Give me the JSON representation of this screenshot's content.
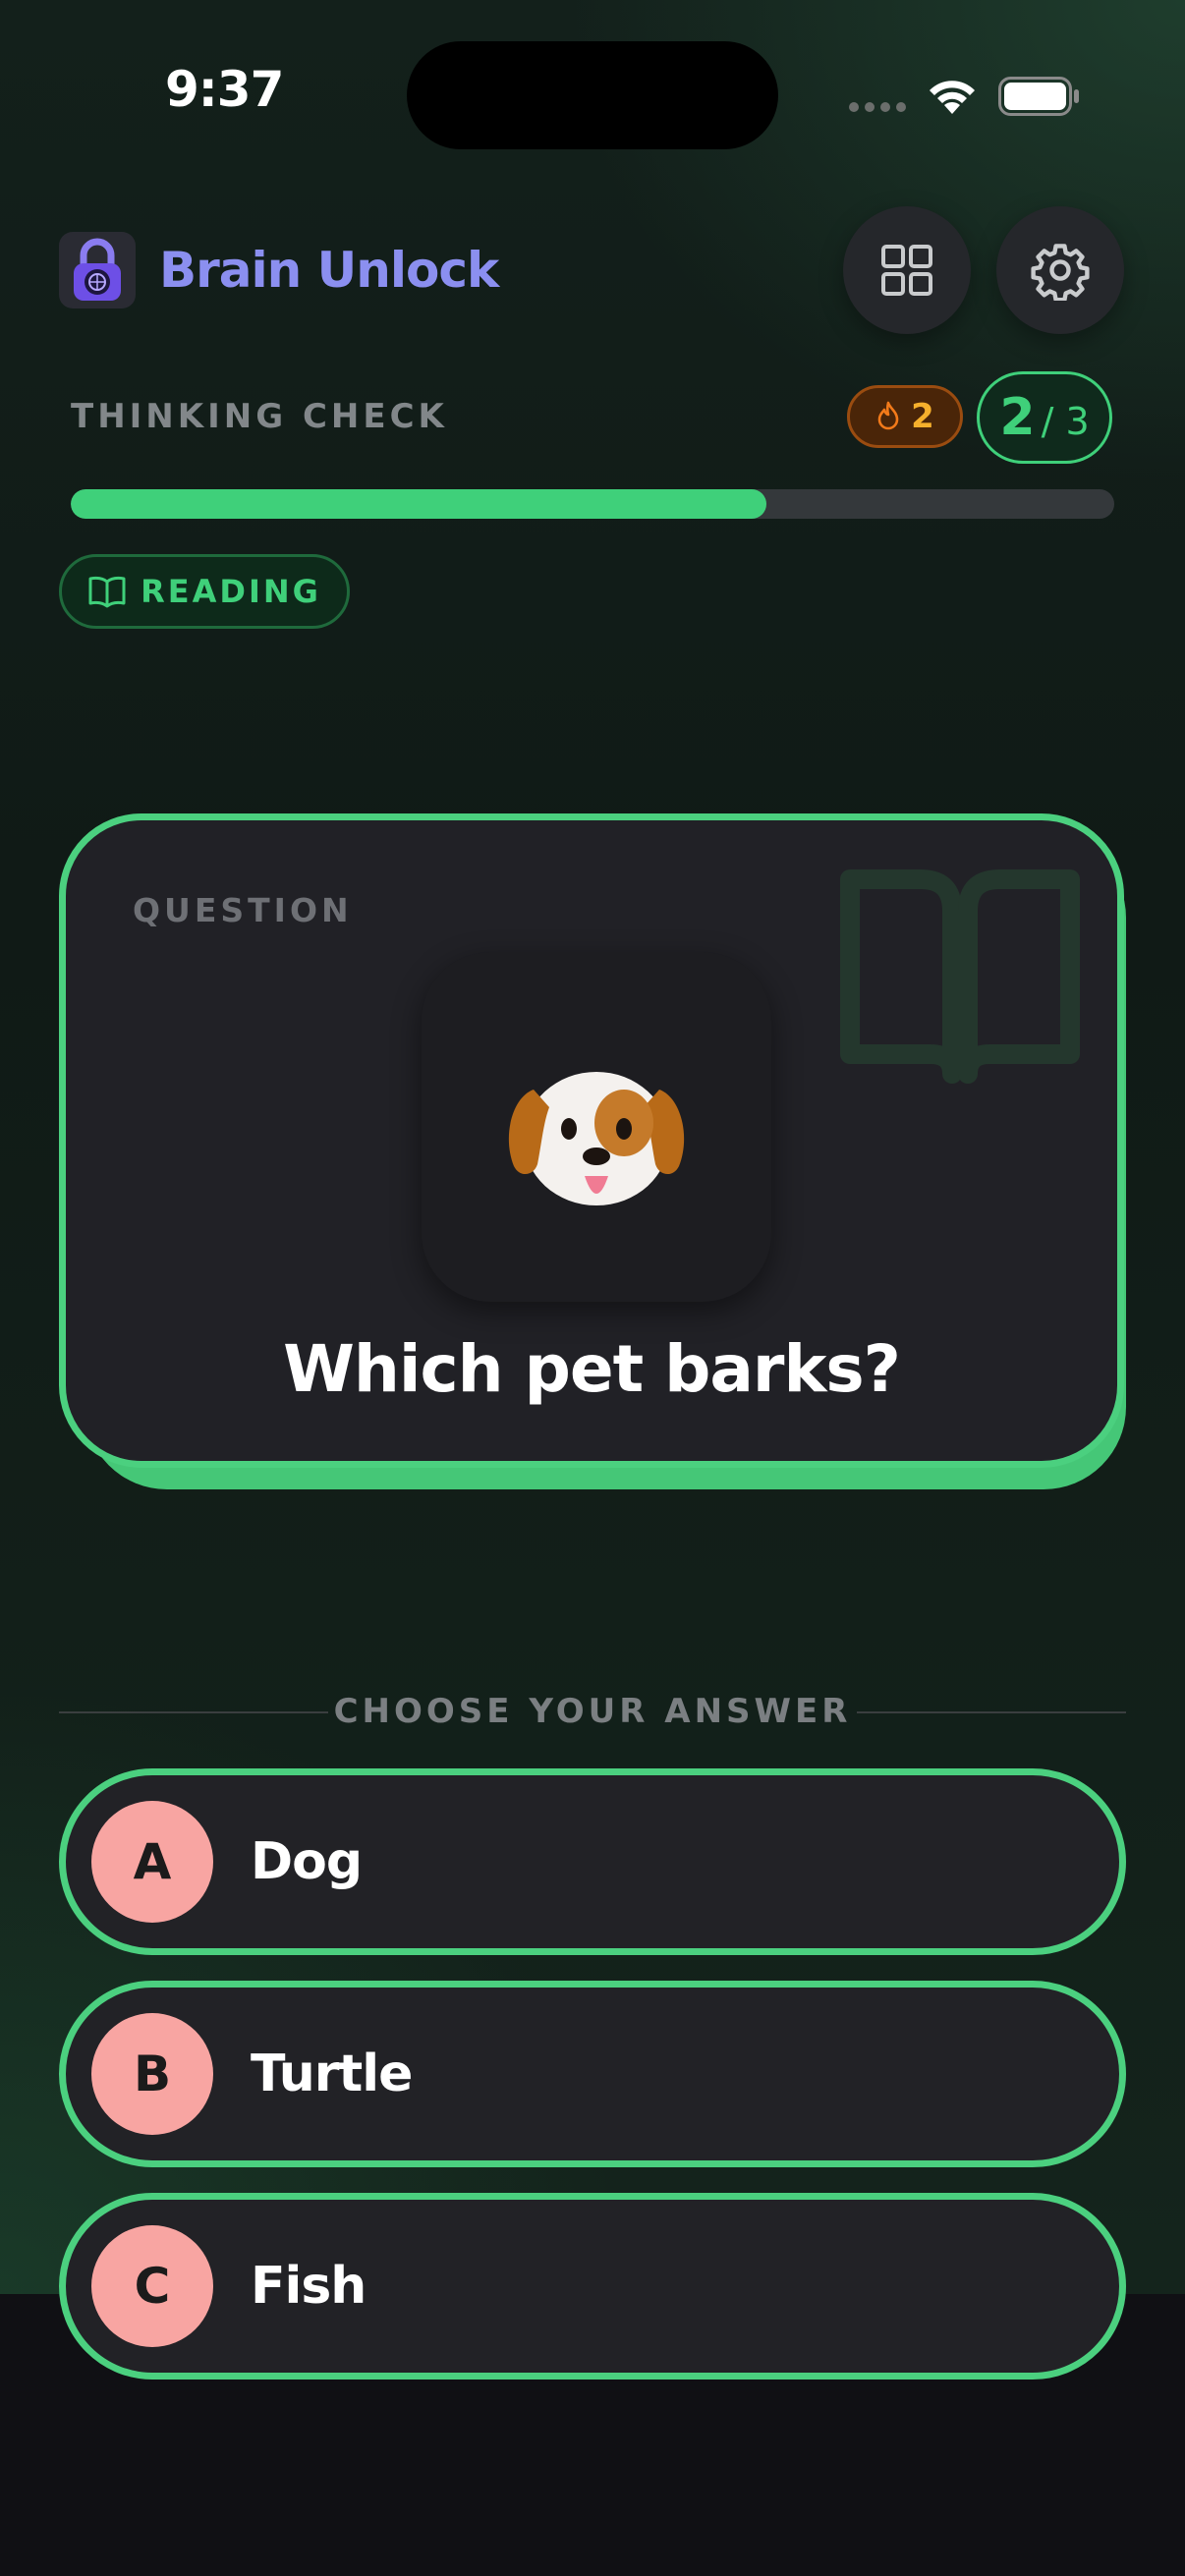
{
  "status_bar": {
    "time": "9:37"
  },
  "header": {
    "app_title": "Brain Unlock",
    "icons": {
      "logo": "lock-brain-logo",
      "grid": "grid-icon",
      "settings": "gear-icon"
    }
  },
  "session": {
    "label": "THINKING CHECK",
    "streak": "2",
    "progress_current": "2",
    "progress_total": "/ 3",
    "progress_fraction": 0.667
  },
  "category": {
    "label": "READING",
    "icon": "book-open-icon"
  },
  "question": {
    "section_label": "QUESTION",
    "emoji": "🐶",
    "text": "Which pet barks?"
  },
  "answers": {
    "heading": "CHOOSE YOUR ANSWER",
    "options": [
      {
        "letter": "A",
        "text": "Dog"
      },
      {
        "letter": "B",
        "text": "Turtle"
      },
      {
        "letter": "C",
        "text": "Fish"
      }
    ]
  },
  "colors": {
    "accent_green": "#3fd07a",
    "title_purple": "#8b8ff0",
    "letter_pink": "#f8a5a2",
    "streak_orange": "#f6b02c"
  }
}
